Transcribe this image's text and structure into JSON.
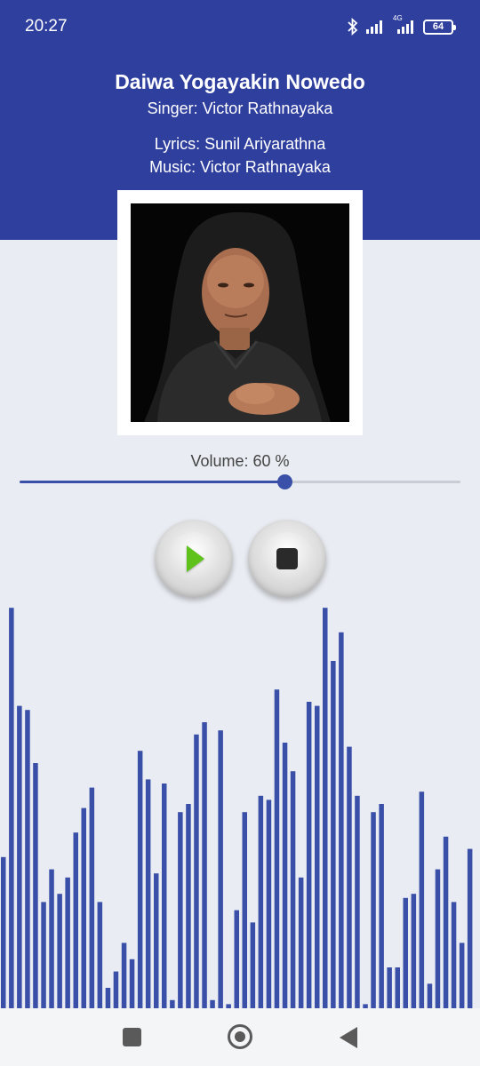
{
  "status_bar": {
    "time": "20:27",
    "network_label": "4G",
    "battery": "64"
  },
  "song": {
    "title": "Daiwa Yogayakin Nowedo",
    "singer": "Singer: Victor Rathnayaka",
    "lyrics": "Lyrics: Sunil Ariyarathna",
    "music": "Music: Victor Rathnayaka"
  },
  "volume": {
    "label": "Volume: 60 %",
    "value_fraction": 0.6
  },
  "controls": {
    "play_icon": "play-icon",
    "stop_icon": "stop-icon"
  },
  "colors": {
    "header_bg": "#2f3f9e",
    "accent": "#3a4fa8",
    "visualizer_bar": "#3a4fa8",
    "play_green": "#5fc21a"
  },
  "visualizer_levels": [
    0.37,
    0.98,
    0.74,
    0.73,
    0.6,
    0.26,
    0.34,
    0.28,
    0.32,
    0.43,
    0.49,
    0.54,
    0.26,
    0.05,
    0.09,
    0.16,
    0.12,
    0.63,
    0.56,
    0.33,
    0.55,
    0.02,
    0.48,
    0.5,
    0.67,
    0.7,
    0.02,
    0.68,
    0.01,
    0.24,
    0.48,
    0.21,
    0.52,
    0.51,
    0.78,
    0.65,
    0.58,
    0.32,
    0.75,
    0.74,
    0.98,
    0.85,
    0.92,
    0.64,
    0.52,
    0.01,
    0.48,
    0.5,
    0.1,
    0.1,
    0.27,
    0.28,
    0.53,
    0.06,
    0.34,
    0.42,
    0.26,
    0.16,
    0.39
  ],
  "navbar": {
    "recents_icon": "recents-square-icon",
    "home_icon": "home-circle-icon",
    "back_icon": "back-triangle-icon"
  }
}
